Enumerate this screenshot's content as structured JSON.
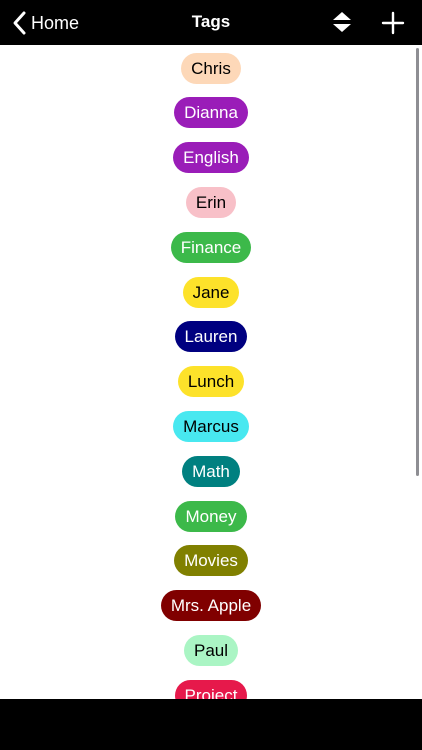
{
  "nav": {
    "back_label": "Home",
    "title": "Tags",
    "sort_icon": "sort-up-down-icon",
    "add_icon": "plus-icon"
  },
  "tags": [
    {
      "label": "Chris",
      "bg": "#fdd8b8",
      "fg": "#000000"
    },
    {
      "label": "Dianna",
      "bg": "#9a1db8",
      "fg": "#ffffff"
    },
    {
      "label": "English",
      "bg": "#9a1db8",
      "fg": "#ffffff"
    },
    {
      "label": "Erin",
      "bg": "#f8c0c8",
      "fg": "#000000"
    },
    {
      "label": "Finance",
      "bg": "#3cb94a",
      "fg": "#ffffff"
    },
    {
      "label": "Jane",
      "bg": "#fde22a",
      "fg": "#000000"
    },
    {
      "label": "Lauren",
      "bg": "#000080",
      "fg": "#ffffff"
    },
    {
      "label": "Lunch",
      "bg": "#fde22a",
      "fg": "#000000"
    },
    {
      "label": "Marcus",
      "bg": "#48e8f0",
      "fg": "#000000"
    },
    {
      "label": "Math",
      "bg": "#008080",
      "fg": "#ffffff"
    },
    {
      "label": "Money",
      "bg": "#3cb94a",
      "fg": "#ffffff"
    },
    {
      "label": "Movies",
      "bg": "#808000",
      "fg": "#ffffff"
    },
    {
      "label": "Mrs. Apple",
      "bg": "#800000",
      "fg": "#ffffff"
    },
    {
      "label": "Paul",
      "bg": "#aaf5c4",
      "fg": "#000000"
    },
    {
      "label": "Project",
      "bg": "#e6194b",
      "fg": "#ffffff"
    }
  ]
}
